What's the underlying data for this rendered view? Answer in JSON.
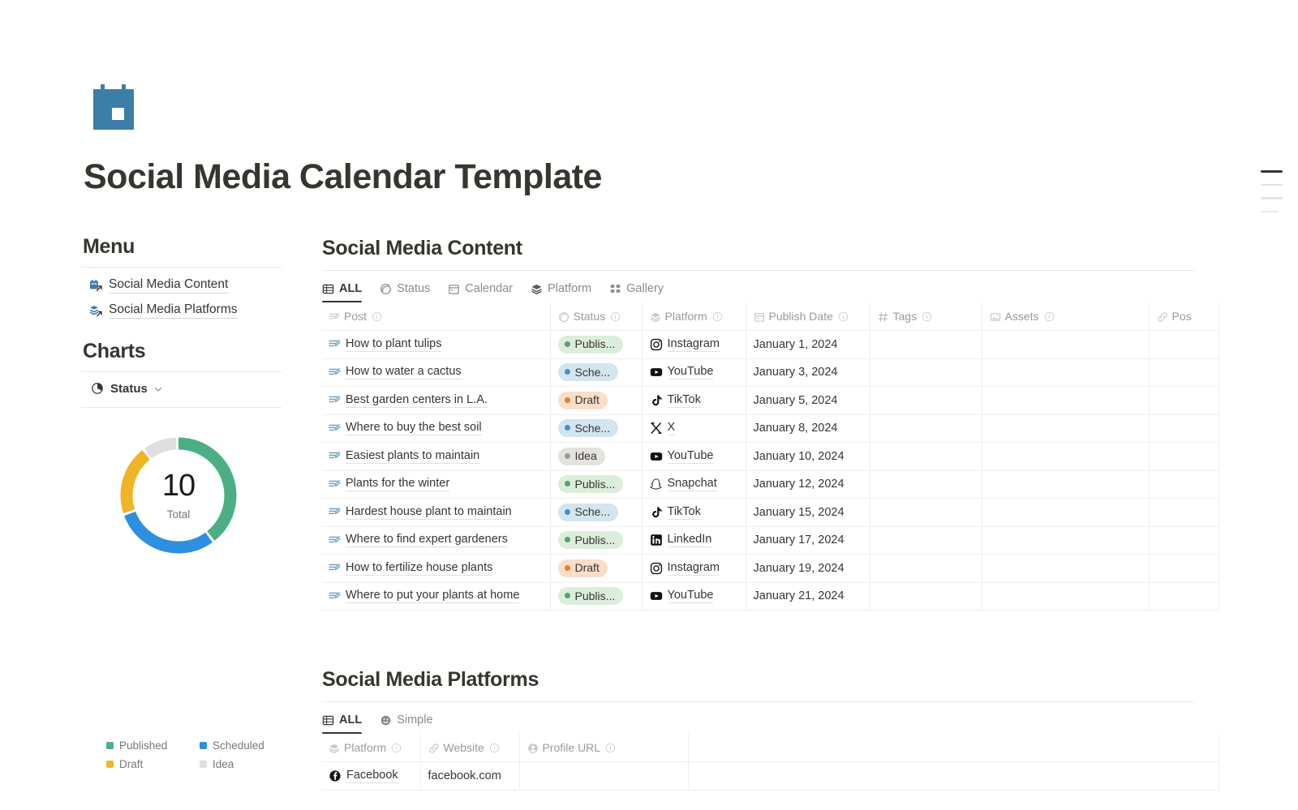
{
  "page": {
    "icon": "calendar-icon",
    "title": "Social Media Calendar Template"
  },
  "sidebar": {
    "menu_heading": "Menu",
    "menu_items": [
      {
        "label": "Social Media Content",
        "icon": "calendar-link-icon"
      },
      {
        "label": "Social Media Platforms",
        "icon": "layers-link-icon"
      }
    ],
    "charts_heading": "Charts",
    "chart_selector": {
      "label": "Status",
      "icon": "pie-chart-icon",
      "chevron": "chevron-down-icon"
    }
  },
  "chart_data": {
    "type": "pie",
    "title": "Status",
    "center_value": "10",
    "center_label": "Total",
    "total": 10,
    "categories": [
      "Published",
      "Scheduled",
      "Draft",
      "Idea"
    ],
    "values": [
      4,
      3,
      2,
      1
    ],
    "colors": [
      "#4caf84",
      "#2e8fe0",
      "#f0b429",
      "#dedede"
    ],
    "legend_position": "bottom",
    "legend": [
      {
        "label": "Published",
        "color": "#4caf84",
        "value": 4
      },
      {
        "label": "Scheduled",
        "color": "#2e8fe0",
        "value": 3
      },
      {
        "label": "Draft",
        "color": "#f0b429",
        "value": 2
      },
      {
        "label": "Idea",
        "color": "#dedede",
        "value": 1
      }
    ]
  },
  "content_db": {
    "title": "Social Media Content",
    "tabs": [
      {
        "label": "ALL",
        "icon": "table-icon",
        "active": true
      },
      {
        "label": "Status",
        "icon": "status-circle-icon",
        "active": false
      },
      {
        "label": "Calendar",
        "icon": "calendar-view-icon",
        "active": false
      },
      {
        "label": "Platform",
        "icon": "layers-icon",
        "active": false
      },
      {
        "label": "Gallery",
        "icon": "gallery-icon",
        "active": false
      }
    ],
    "columns": [
      {
        "label": "Post",
        "icon": "text-lines-icon"
      },
      {
        "label": "Status",
        "icon": "status-circle-icon"
      },
      {
        "label": "Platform",
        "icon": "layers-icon"
      },
      {
        "label": "Publish Date",
        "icon": "calendar-view-icon"
      },
      {
        "label": "Tags",
        "icon": "hash-icon"
      },
      {
        "label": "Assets",
        "icon": "image-icon"
      },
      {
        "label": "Pos",
        "icon": "link-icon"
      }
    ],
    "rows": [
      {
        "post": "How to plant tulips",
        "status": "Publis...",
        "status_key": "published",
        "platform": "Instagram",
        "platform_icon": "instagram-icon",
        "date": "January 1, 2024",
        "tags": "",
        "assets": "",
        "post_url": ""
      },
      {
        "post": "How to water a cactus",
        "status": "Sche...",
        "status_key": "scheduled",
        "platform": "YouTube",
        "platform_icon": "youtube-icon",
        "date": "January 3, 2024",
        "tags": "",
        "assets": "",
        "post_url": ""
      },
      {
        "post": "Best garden centers in L.A.",
        "status": "Draft",
        "status_key": "draft",
        "platform": "TikTok",
        "platform_icon": "tiktok-icon",
        "date": "January 5, 2024",
        "tags": "",
        "assets": "",
        "post_url": ""
      },
      {
        "post": "Where to buy the best soil",
        "status": "Sche...",
        "status_key": "scheduled",
        "platform": "X",
        "platform_icon": "x-icon",
        "date": "January 8, 2024",
        "tags": "",
        "assets": "",
        "post_url": ""
      },
      {
        "post": "Easiest plants to maintain",
        "status": "Idea",
        "status_key": "idea",
        "platform": "YouTube",
        "platform_icon": "youtube-icon",
        "date": "January 10, 2024",
        "tags": "",
        "assets": "",
        "post_url": ""
      },
      {
        "post": "Plants for the winter",
        "status": "Publis...",
        "status_key": "published",
        "platform": "Snapchat",
        "platform_icon": "snapchat-icon",
        "date": "January 12, 2024",
        "tags": "",
        "assets": "",
        "post_url": ""
      },
      {
        "post": "Hardest house plant to maintain",
        "status": "Sche...",
        "status_key": "scheduled",
        "platform": "TikTok",
        "platform_icon": "tiktok-icon",
        "date": "January 15, 2024",
        "tags": "",
        "assets": "",
        "post_url": ""
      },
      {
        "post": "Where to find expert gardeners",
        "status": "Publis...",
        "status_key": "published",
        "platform": "LinkedIn",
        "platform_icon": "linkedin-icon",
        "date": "January 17, 2024",
        "tags": "",
        "assets": "",
        "post_url": ""
      },
      {
        "post": "How to fertilize house plants",
        "status": "Draft",
        "status_key": "draft",
        "platform": "Instagram",
        "platform_icon": "instagram-icon",
        "date": "January 19, 2024",
        "tags": "",
        "assets": "",
        "post_url": ""
      },
      {
        "post": "Where to put your plants at home",
        "status": "Publis...",
        "status_key": "published",
        "platform": "YouTube",
        "platform_icon": "youtube-icon",
        "date": "January 21, 2024",
        "tags": "",
        "assets": "",
        "post_url": ""
      }
    ]
  },
  "platforms_db": {
    "title": "Social Media Platforms",
    "tabs": [
      {
        "label": "ALL",
        "icon": "table-icon",
        "active": true
      },
      {
        "label": "Simple",
        "icon": "smiley-icon",
        "active": false
      }
    ],
    "columns": [
      {
        "label": "Platform",
        "icon": "layers-icon"
      },
      {
        "label": "Website",
        "icon": "link-icon"
      },
      {
        "label": "Profile URL",
        "icon": "person-icon"
      }
    ],
    "rows": [
      {
        "platform": "Facebook",
        "platform_icon": "facebook-icon",
        "website": "facebook.com",
        "profile_url": ""
      }
    ]
  },
  "status_styles": {
    "published": {
      "bg": "#dbeddb",
      "dot": "#5a9e6f",
      "fg": "#37352f"
    },
    "scheduled": {
      "bg": "#d3e5ef",
      "dot": "#4a90c4",
      "fg": "#37352f"
    },
    "draft": {
      "bg": "#fadec9",
      "dot": "#d9832c",
      "fg": "#37352f"
    },
    "idea": {
      "bg": "#e3e2e0",
      "dot": "#9b9a97",
      "fg": "#37352f"
    }
  },
  "toc": {
    "bars": [
      {
        "active": true
      },
      {
        "active": false
      },
      {
        "active": false
      },
      {
        "active": false
      }
    ]
  }
}
